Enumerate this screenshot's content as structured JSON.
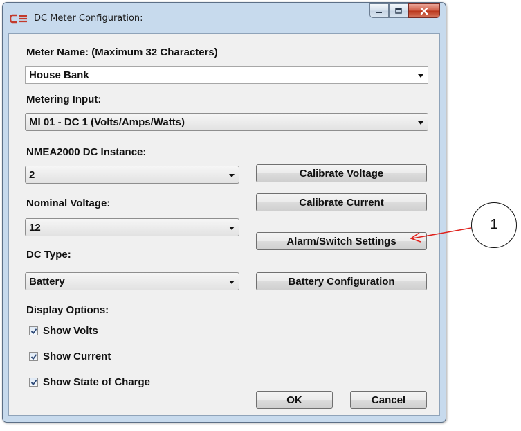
{
  "window": {
    "title": "DC Meter Configuration:",
    "minimize_icon": "minimize-icon",
    "maximize_icon": "maximize-icon",
    "close_icon": "close-icon"
  },
  "meter_name": {
    "label": "Meter Name: (Maximum 32 Characters)",
    "value": "House Bank"
  },
  "metering_input": {
    "label": "Metering Input:",
    "value": "MI 01 - DC 1 (Volts/Amps/Watts)"
  },
  "nmea_instance": {
    "label": "NMEA2000 DC Instance:",
    "value": "2"
  },
  "nominal_voltage": {
    "label": "Nominal Voltage:",
    "value": "12"
  },
  "dc_type": {
    "label": "DC Type:",
    "value": "Battery"
  },
  "buttons": {
    "calibrate_voltage": "Calibrate Voltage",
    "calibrate_current": "Calibrate Current",
    "alarm_switch": "Alarm/Switch Settings",
    "battery_config": "Battery Configuration",
    "ok": "OK",
    "cancel": "Cancel"
  },
  "display_options": {
    "label": "Display Options:",
    "items": [
      {
        "label": "Show Volts",
        "checked": true
      },
      {
        "label": "Show Current",
        "checked": true
      },
      {
        "label": "Show State of Charge",
        "checked": true
      }
    ]
  },
  "callout": {
    "number": "1",
    "color": "#e0201b"
  }
}
